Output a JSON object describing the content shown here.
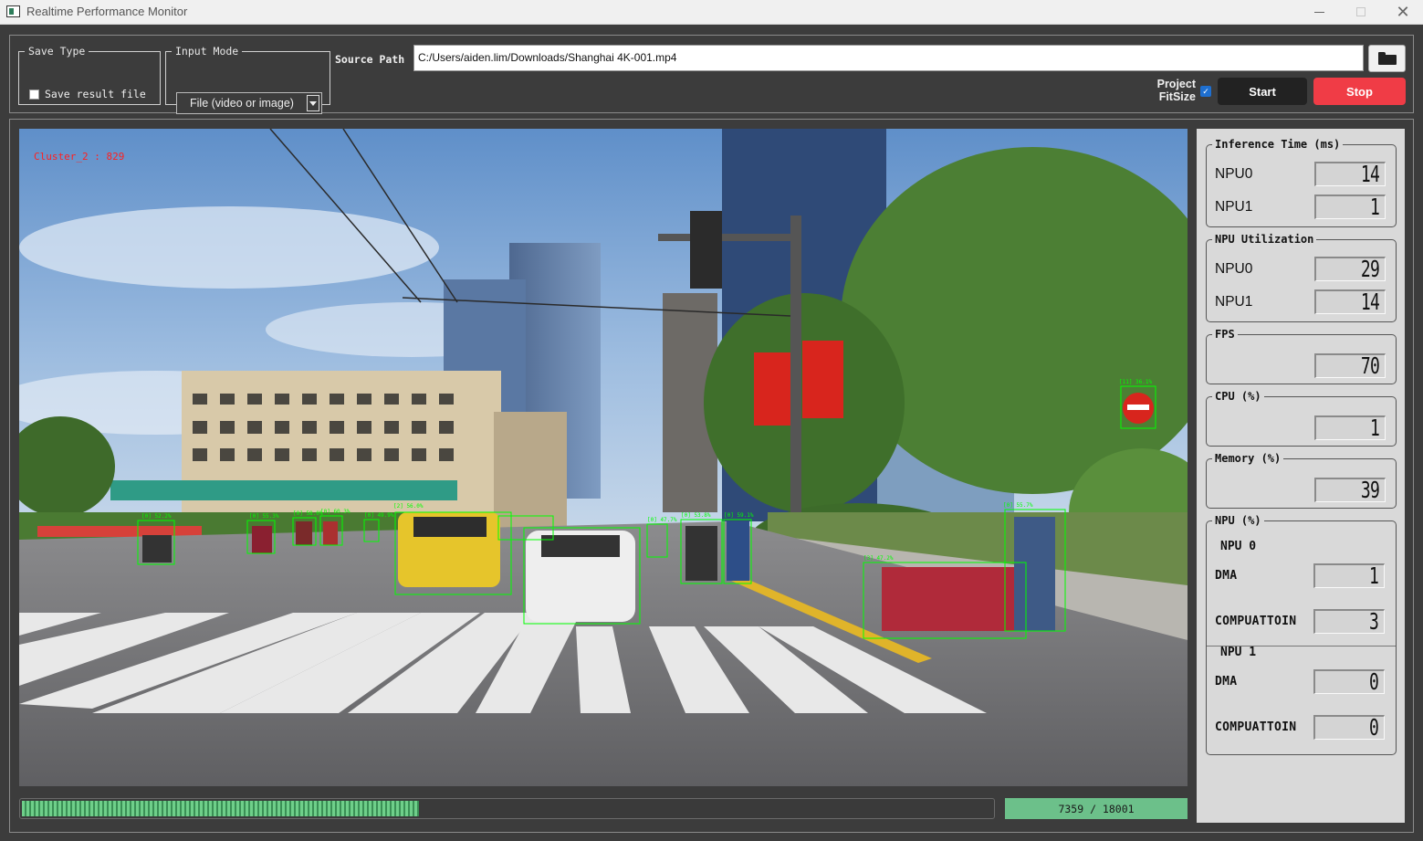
{
  "window": {
    "title": "Realtime Performance Monitor"
  },
  "save_type": {
    "legend": "Save Type",
    "checkbox_label": "Save result file",
    "checked": false
  },
  "input_mode": {
    "legend": "Input Mode",
    "selected": "File (video or image)"
  },
  "source": {
    "label": "Source Path",
    "value": "C:/Users/aiden.lim/Downloads/Shanghai 4K-001.mp4"
  },
  "controls": {
    "project_fitsize_label_1": "Project",
    "project_fitsize_label_2": "FitSize",
    "project_fitsize_checked": true,
    "start_label": "Start",
    "stop_label": "Stop"
  },
  "video": {
    "cluster_label": "Cluster_2 : 829",
    "detections": [
      "[0] 52.2%",
      "[0] 55.3%",
      "[0] 58.0%",
      "[0] 60.3%",
      "[0] 49.9%",
      "[2] 56.0%",
      "[0] 47.7%",
      "[0] 53.8%",
      "[0] 59.1%",
      "[3] 47.2%",
      "[0] 55.7%",
      "[11] 36.1%"
    ]
  },
  "progress": {
    "current": 7359,
    "total": 18001,
    "text": "7359 / 18001",
    "fraction": 0.4088
  },
  "metrics": {
    "inference": {
      "legend": "Inference Time (ms)",
      "npu0_label": "NPU0",
      "npu0_value": "14",
      "npu1_label": "NPU1",
      "npu1_value": "1"
    },
    "utilization": {
      "legend": "NPU Utilization",
      "npu0_label": "NPU0",
      "npu0_value": "29",
      "npu1_label": "NPU1",
      "npu1_value": "14"
    },
    "fps": {
      "legend": "FPS",
      "value": "70"
    },
    "cpu": {
      "legend": "CPU (%)",
      "value": "1"
    },
    "memory": {
      "legend": "Memory (%)",
      "value": "39"
    },
    "npu_pct": {
      "legend": "NPU (%)",
      "npu0_heading": "NPU 0",
      "npu0_dma_label": "DMA",
      "npu0_dma_value": "1",
      "npu0_comp_label": "COMPUATTOIN",
      "npu0_comp_value": "3",
      "npu1_heading": "NPU 1",
      "npu1_dma_label": "DMA",
      "npu1_dma_value": "0",
      "npu1_comp_label": "COMPUATTOIN",
      "npu1_comp_value": "0"
    }
  },
  "colors": {
    "stop_button": "#f03c46",
    "start_button": "#222222",
    "progress_fill": "#6fcf8a",
    "detection_box": "#00ff00",
    "cluster_text": "#ff2020"
  }
}
